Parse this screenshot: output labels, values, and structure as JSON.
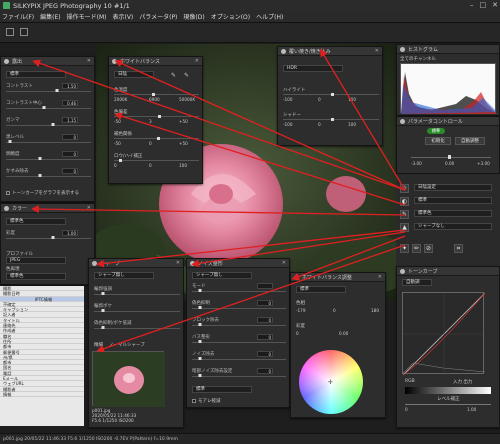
{
  "window": {
    "title": "SILKYPIX JPEG Photography 10 #1/1"
  },
  "menu": [
    "ファイル(F)",
    "編集(E)",
    "操作モード(M)",
    "表示(V)",
    "パラメータ(P)",
    "現像(D)",
    "オプション(O)",
    "ヘルプ(H)"
  ],
  "exposure_panel": {
    "title": "露出",
    "preset": "標準",
    "sliders": [
      {
        "label": "コントラスト",
        "value": "1.50"
      },
      {
        "label": "コントラスト中心",
        "value": "0.46"
      },
      {
        "label": "ガンマ",
        "value": "1.15"
      },
      {
        "label": "黒レベル",
        "value": "0"
      },
      {
        "label": "明瞭度",
        "value": "0"
      },
      {
        "label": "かすみ除去",
        "value": "0"
      }
    ],
    "checkbox": "トーンカーブをグラフを表示する"
  },
  "color_panel": {
    "title": "カラー",
    "preset": "標準色",
    "saturation_label": "彩度",
    "saturation_value": "1.00",
    "profile_label": "プロファイル",
    "profile_value": "JPEG",
    "colorspace_label": "色再現",
    "colorspace_value": "標準色"
  },
  "wb_panel": {
    "title": "ホワイトバランス",
    "preset": "日陰",
    "temp_label": "色温度",
    "temp_values": [
      "2000K",
      "6900",
      "50000K"
    ],
    "tint_label": "色偏差",
    "tint_values": [
      "-50",
      "3",
      "+50"
    ],
    "tone_label": "補色関係",
    "tone_values": [
      "-50",
      "0",
      "+50"
    ],
    "dark_label": "ロウ/ハイ補正",
    "dark_values": [
      "0",
      "0",
      "100"
    ]
  },
  "hdr_panel": {
    "title": "覆い焼き/焼き込み",
    "mode": "HDR",
    "highlight_label": "ハイライト",
    "highlight_values": [
      "-100",
      "0",
      "100"
    ],
    "shadow_label": "シャドー",
    "shadow_values": [
      "-100",
      "0",
      "100"
    ]
  },
  "sharp_panel": {
    "title": "シャープ",
    "preset": "シャープ無し",
    "rows": [
      "輪郭強調",
      "輪郭ボケ",
      "偽色抑制/ボケ低減"
    ],
    "mode_label": "精細",
    "mode_value": "ノーマルシャープ"
  },
  "noise_panel": {
    "title": "ノイズ整形",
    "preset": "シャープ無し",
    "rows": [
      {
        "label": "モード",
        "value": ""
      },
      {
        "label": "偽色抑制",
        "value": "0"
      },
      {
        "label": "ブロック除去",
        "value": "0"
      },
      {
        "label": "バス整形",
        "value": "0"
      },
      {
        "label": "ノイズ除去",
        "value": "0"
      },
      {
        "label": "暗部ノイズ除去設定",
        "value": "0"
      }
    ],
    "dropdown": "標準",
    "checkbox": "モアレ軽減"
  },
  "hue_panel": {
    "title": "ホワイトバランス調整",
    "preset": "標準",
    "hue_label": "色相",
    "hue_values": [
      "-179",
      "0",
      "180"
    ],
    "sat_label": "彩度",
    "sat_values": [
      "0",
      "0.00"
    ]
  },
  "histogram": {
    "title": "ヒストグラム",
    "channel": "全てのチャンネル"
  },
  "param_control": {
    "title": "パラメータコントロール",
    "pill": "標準",
    "btn1": "初期化",
    "btn2": "自動調整",
    "values": [
      "-3.00",
      "0.00",
      "+3.00"
    ],
    "dropdowns": [
      "日陰設定",
      "標準",
      "標準色",
      "シャープなし"
    ]
  },
  "tone_curve": {
    "title": "トーンカーブ",
    "mode": "自動調",
    "channel": "RGB",
    "io_label": "入力 出力",
    "level_label": "レベル補正",
    "level_values": [
      "0",
      "1.00"
    ]
  },
  "list_panel": {
    "items": [
      "撮影",
      "撮影日時",
      "IPTC情報",
      "不確定",
      "キャプション",
      "記入者",
      "タイトル",
      "連絡先",
      "作成者",
      "職名",
      "住所",
      "都市",
      "郵便番号",
      "州/県",
      "都市",
      "国名",
      "電話",
      "Eメール",
      "ウェブURL",
      "撮影者",
      "情報"
    ]
  },
  "thumbnail": {
    "filename": "p001.jpg",
    "datetime": "2020/05/22 11:46:33",
    "exposure": "F5.6 1/1250 ISO200"
  },
  "statusbar": "p001.jpg 20/05/22 11:46:33 F5.6 1/1250 ISO200 -0.7EV P(Pattern) f=10.9mm"
}
